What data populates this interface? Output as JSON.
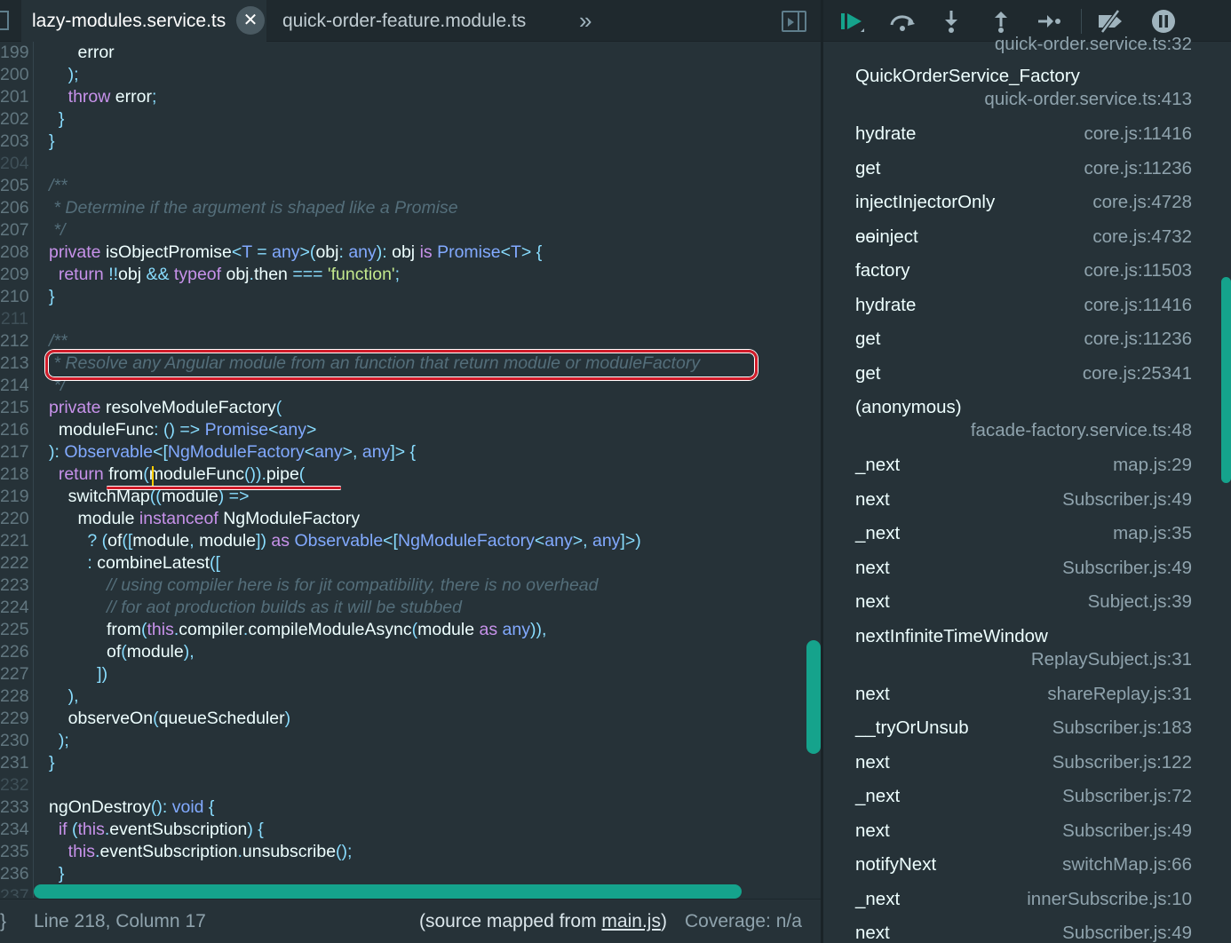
{
  "tabs": [
    {
      "label": "lazy-modules.service.ts",
      "active": true,
      "close": "✕"
    },
    {
      "label": "quick-order-feature.module.ts",
      "active": false
    }
  ],
  "tab_overflow": "»",
  "code": {
    "lines": [
      {
        "n": "199",
        "tokens": [
          [
            "",
            "      error"
          ]
        ]
      },
      {
        "n": "200",
        "tokens": [
          [
            "pn",
            "    );"
          ]
        ]
      },
      {
        "n": "201",
        "tokens": [
          [
            "kw",
            "    throw"
          ],
          [
            "",
            " error"
          ],
          [
            "pn",
            ";"
          ]
        ]
      },
      {
        "n": "202",
        "tokens": [
          [
            "pn",
            "  }"
          ]
        ]
      },
      {
        "n": "203",
        "tokens": [
          [
            "pn",
            "}"
          ]
        ]
      },
      {
        "n": "204",
        "tokens": []
      },
      {
        "n": "205",
        "tokens": [
          [
            "cm",
            "/**"
          ]
        ]
      },
      {
        "n": "206",
        "tokens": [
          [
            "cm",
            " * Determine if the argument is shaped like a Promise"
          ]
        ]
      },
      {
        "n": "207",
        "tokens": [
          [
            "cm",
            " */"
          ]
        ]
      },
      {
        "n": "208",
        "tokens": [
          [
            "kw",
            "private"
          ],
          [
            "",
            " isObjectPromise"
          ],
          [
            "pn",
            "<"
          ],
          [
            "ty",
            "T"
          ],
          [
            "pn",
            " = "
          ],
          [
            "ty",
            "any"
          ],
          [
            "pn",
            ">("
          ],
          [
            "",
            "obj"
          ],
          [
            "pn",
            ": "
          ],
          [
            "ty",
            "any"
          ],
          [
            "pn",
            "): "
          ],
          [
            "",
            "obj "
          ],
          [
            "kw",
            "is"
          ],
          [
            "ty",
            " Promise"
          ],
          [
            "pn",
            "<"
          ],
          [
            "ty",
            "T"
          ],
          [
            "pn",
            "> {"
          ]
        ]
      },
      {
        "n": "209",
        "tokens": [
          [
            "kw",
            "  return"
          ],
          [
            "pn",
            " !!"
          ],
          [
            "",
            "obj "
          ],
          [
            "pn",
            "&&"
          ],
          [
            "kw",
            " typeof"
          ],
          [
            "",
            " obj"
          ],
          [
            "pn",
            "."
          ],
          [
            "",
            "then "
          ],
          [
            "pn",
            "==="
          ],
          [
            "st",
            " 'function'"
          ],
          [
            "pn",
            ";"
          ]
        ]
      },
      {
        "n": "210",
        "tokens": [
          [
            "pn",
            "}"
          ]
        ]
      },
      {
        "n": "211",
        "tokens": []
      },
      {
        "n": "212",
        "tokens": [
          [
            "cm",
            "/**"
          ]
        ]
      },
      {
        "n": "213",
        "tokens": [
          [
            "cm",
            " * Resolve any Angular module from an function that return module or moduleFactory"
          ]
        ]
      },
      {
        "n": "214",
        "tokens": [
          [
            "cm",
            " */"
          ]
        ]
      },
      {
        "n": "215",
        "tokens": [
          [
            "kw",
            "private"
          ],
          [
            "",
            " resolveModuleFactory"
          ],
          [
            "pn",
            "("
          ]
        ]
      },
      {
        "n": "216",
        "tokens": [
          [
            "",
            "  moduleFunc"
          ],
          [
            "pn",
            ": () => "
          ],
          [
            "ty",
            "Promise"
          ],
          [
            "pn",
            "<"
          ],
          [
            "ty",
            "any"
          ],
          [
            "pn",
            ">"
          ]
        ]
      },
      {
        "n": "217",
        "tokens": [
          [
            "pn",
            "): "
          ],
          [
            "ty",
            "Observable"
          ],
          [
            "pn",
            "<["
          ],
          [
            "ty",
            "NgModuleFactory"
          ],
          [
            "pn",
            "<"
          ],
          [
            "ty",
            "any"
          ],
          [
            "pn",
            ">, "
          ],
          [
            "ty",
            "any"
          ],
          [
            "pn",
            "]> {"
          ]
        ]
      },
      {
        "n": "218",
        "tokens": [
          [
            "kw",
            "  return"
          ],
          [
            "",
            " from"
          ],
          [
            "pn",
            "("
          ],
          [
            "",
            "moduleFunc"
          ],
          [
            "pn",
            "())."
          ],
          [
            "",
            "pipe"
          ],
          [
            "pn",
            "("
          ]
        ]
      },
      {
        "n": "219",
        "tokens": [
          [
            "",
            "    switchMap"
          ],
          [
            "pn",
            "(("
          ],
          [
            "",
            "module"
          ],
          [
            "pn",
            ") =>"
          ]
        ]
      },
      {
        "n": "220",
        "tokens": [
          [
            "",
            "      module "
          ],
          [
            "kw",
            "instanceof"
          ],
          [
            "",
            " NgModuleFactory"
          ]
        ]
      },
      {
        "n": "221",
        "tokens": [
          [
            "pn",
            "        ? ("
          ],
          [
            "",
            "of"
          ],
          [
            "pn",
            "(["
          ],
          [
            "",
            "module"
          ],
          [
            "pn",
            ", "
          ],
          [
            "",
            "module"
          ],
          [
            "pn",
            "]) "
          ],
          [
            "kw",
            "as"
          ],
          [
            "ty",
            " Observable"
          ],
          [
            "pn",
            "<["
          ],
          [
            "ty",
            "NgModuleFactory"
          ],
          [
            "pn",
            "<"
          ],
          [
            "ty",
            "any"
          ],
          [
            "pn",
            ">, "
          ],
          [
            "ty",
            "any"
          ],
          [
            "pn",
            "]>)"
          ]
        ]
      },
      {
        "n": "222",
        "tokens": [
          [
            "pn",
            "        : "
          ],
          [
            "",
            "combineLatest"
          ],
          [
            "pn",
            "(["
          ]
        ]
      },
      {
        "n": "223",
        "tokens": [
          [
            "cm",
            "            // using compiler here is for jit compatibility, there is no overhead"
          ]
        ]
      },
      {
        "n": "224",
        "tokens": [
          [
            "cm",
            "            // for aot production builds as it will be stubbed"
          ]
        ]
      },
      {
        "n": "225",
        "tokens": [
          [
            "",
            "            from"
          ],
          [
            "pn",
            "("
          ],
          [
            "kw",
            "this"
          ],
          [
            "pn",
            "."
          ],
          [
            "",
            "compiler"
          ],
          [
            "pn",
            "."
          ],
          [
            "",
            "compileModuleAsync"
          ],
          [
            "pn",
            "("
          ],
          [
            "",
            "module "
          ],
          [
            "kw",
            "as"
          ],
          [
            "ty",
            " any"
          ],
          [
            "pn",
            ")),"
          ]
        ]
      },
      {
        "n": "226",
        "tokens": [
          [
            "",
            "            of"
          ],
          [
            "pn",
            "("
          ],
          [
            "",
            "module"
          ],
          [
            "pn",
            "),"
          ]
        ]
      },
      {
        "n": "227",
        "tokens": [
          [
            "pn",
            "          ])"
          ]
        ]
      },
      {
        "n": "228",
        "tokens": [
          [
            "pn",
            "    ),"
          ]
        ]
      },
      {
        "n": "229",
        "tokens": [
          [
            "",
            "    observeOn"
          ],
          [
            "pn",
            "("
          ],
          [
            "",
            "queueScheduler"
          ],
          [
            "pn",
            ")"
          ]
        ]
      },
      {
        "n": "230",
        "tokens": [
          [
            "pn",
            "  );"
          ]
        ]
      },
      {
        "n": "231",
        "tokens": [
          [
            "pn",
            "}"
          ]
        ]
      },
      {
        "n": "232",
        "tokens": []
      },
      {
        "n": "233",
        "tokens": [
          [
            "",
            "ngOnDestroy"
          ],
          [
            "pn",
            "(): "
          ],
          [
            "ty",
            "void"
          ],
          [
            "pn",
            " {"
          ]
        ]
      },
      {
        "n": "234",
        "tokens": [
          [
            "kw",
            "  if"
          ],
          [
            "pn",
            " ("
          ],
          [
            "kw",
            "this"
          ],
          [
            "pn",
            "."
          ],
          [
            "",
            "eventSubscription"
          ],
          [
            "pn",
            ") {"
          ]
        ]
      },
      {
        "n": "235",
        "tokens": [
          [
            "kw",
            "    this"
          ],
          [
            "pn",
            "."
          ],
          [
            "",
            "eventSubscription"
          ],
          [
            "pn",
            "."
          ],
          [
            "",
            "unsubscribe"
          ],
          [
            "pn",
            "();"
          ]
        ]
      },
      {
        "n": "236",
        "tokens": [
          [
            "pn",
            "  }"
          ]
        ]
      },
      {
        "n": "237",
        "tokens": []
      }
    ]
  },
  "status": {
    "brace": "}",
    "position": "Line 218, Column 17",
    "source_prefix": "(source mapped from ",
    "source_link": "main.js",
    "source_suffix": ")",
    "coverage": "Coverage: n/a"
  },
  "debug_toolbar": {
    "buttons": [
      "resume-icon",
      "step-over-icon",
      "step-in-icon",
      "step-out-icon",
      "run-to-icon",
      "deactivate-breakpoints-icon",
      "pause-on-exceptions-icon"
    ]
  },
  "call_stack": {
    "top_cut_location": "quick-order.service.ts:32",
    "frames": [
      {
        "name": "QuickOrderService_Factory",
        "location": "quick-order.service.ts:413",
        "wrap": true
      },
      {
        "name": "hydrate",
        "location": "core.js:11416"
      },
      {
        "name": "get",
        "location": "core.js:11236"
      },
      {
        "name": "injectInjectorOnly",
        "location": "core.js:4728"
      },
      {
        "name": "ɵɵinject",
        "location": "core.js:4732"
      },
      {
        "name": "factory",
        "location": "core.js:11503"
      },
      {
        "name": "hydrate",
        "location": "core.js:11416"
      },
      {
        "name": "get",
        "location": "core.js:11236"
      },
      {
        "name": "get",
        "location": "core.js:25341"
      },
      {
        "name": "(anonymous)",
        "location": "facade-factory.service.ts:48",
        "wrap": true
      },
      {
        "name": "_next",
        "location": "map.js:29"
      },
      {
        "name": "next",
        "location": "Subscriber.js:49"
      },
      {
        "name": "_next",
        "location": "map.js:35"
      },
      {
        "name": "next",
        "location": "Subscriber.js:49"
      },
      {
        "name": "next",
        "location": "Subject.js:39"
      },
      {
        "name": "nextInfiniteTimeWindow",
        "location": "ReplaySubject.js:31",
        "wrap": true
      },
      {
        "name": "next",
        "location": "shareReplay.js:31"
      },
      {
        "name": "__tryOrUnsub",
        "location": "Subscriber.js:183"
      },
      {
        "name": "next",
        "location": "Subscriber.js:122"
      },
      {
        "name": "_next",
        "location": "Subscriber.js:72"
      },
      {
        "name": "next",
        "location": "Subscriber.js:49"
      },
      {
        "name": "notifyNext",
        "location": "switchMap.js:66"
      },
      {
        "name": "_next",
        "location": "innerSubscribe.js:10"
      },
      {
        "name": "next",
        "location": "Subscriber.js:49"
      }
    ]
  },
  "colors": {
    "accent": "#15a38c",
    "highlight_annotation": "#d11c2a",
    "background": "#263238"
  }
}
